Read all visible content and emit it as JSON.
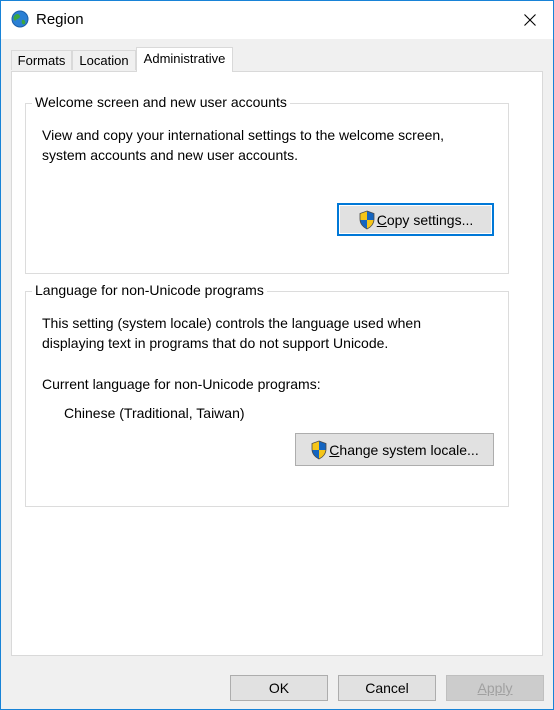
{
  "window": {
    "title": "Region"
  },
  "tabs": [
    {
      "label": "Formats",
      "active": false
    },
    {
      "label": "Location",
      "active": false
    },
    {
      "label": "Administrative",
      "active": true
    }
  ],
  "welcome_group": {
    "title": "Welcome screen and new user accounts",
    "description_line1": "View and copy your international settings to the welcome screen,",
    "description_line2": "system accounts and new user accounts.",
    "copy_button": {
      "mnemonic": "C",
      "rest": "opy settings..."
    }
  },
  "locale_group": {
    "title": "Language for non-Unicode programs",
    "description_line1": "This setting (system locale) controls the language used when",
    "description_line2": "displaying text in programs that do not support Unicode.",
    "current_label": "Current language for non-Unicode programs:",
    "current_value": "Chinese (Traditional, Taiwan)",
    "change_button": {
      "mnemonic": "C",
      "rest": "hange system locale..."
    }
  },
  "footer": {
    "ok": "OK",
    "cancel": "Cancel",
    "apply": "Apply"
  },
  "icons": {
    "title": "globe-icon",
    "close": "close-icon",
    "uac": "uac-shield-icon"
  },
  "colors": {
    "accent": "#0078d7",
    "window_border": "#1883d7",
    "shield_blue": "#1565c0",
    "shield_yellow": "#f5c518"
  }
}
